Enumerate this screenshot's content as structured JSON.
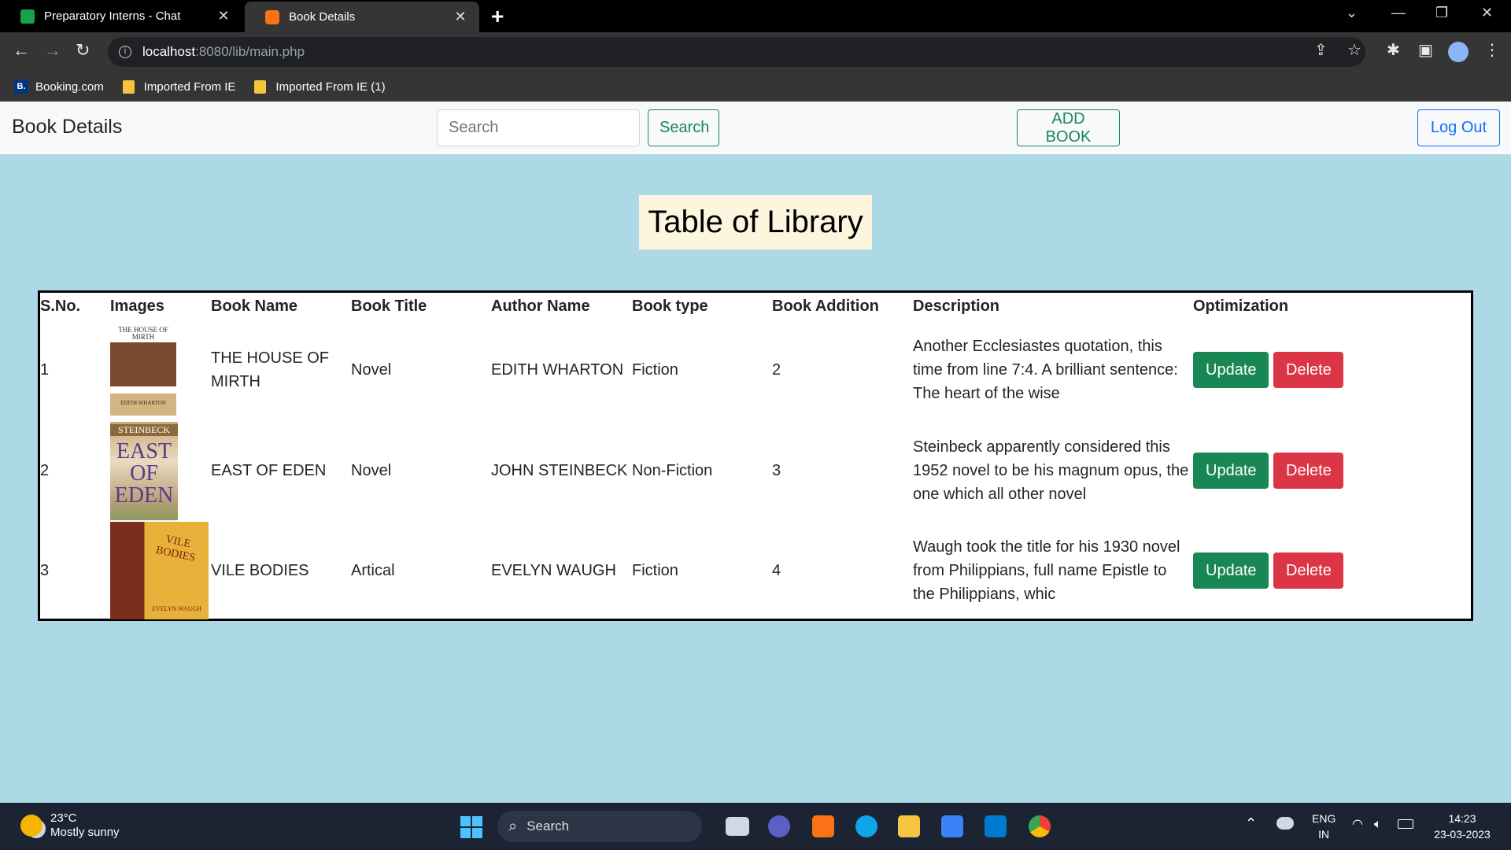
{
  "browser": {
    "tabs": [
      {
        "title": "Preparatory Interns - Chat",
        "icon": "chat-icon"
      },
      {
        "title": "Book Details",
        "icon": "xampp-icon"
      }
    ],
    "url_host": "localhost",
    "url_path": ":8080/lib/main.php",
    "bookmarks": [
      "Booking.com",
      "Imported From IE",
      "Imported From IE (1)"
    ]
  },
  "navbar": {
    "brand": "Book Details",
    "search_placeholder": "Search",
    "search_button": "Search",
    "add_button": "ADD BOOK",
    "logout_button": "Log Out"
  },
  "heading": "Table of Library",
  "table": {
    "headers": [
      "S.No.",
      "Images",
      "Book Name",
      "Book Title",
      "Author Name",
      "Book type",
      "Book Addition",
      "Description",
      "Optimization"
    ],
    "rows": [
      {
        "sno": "1",
        "cover_text_top": "THE HOUSE OF MIRTH",
        "cover_text_bottom": "EDITH WHARTON",
        "book_name": "THE HOUSE OF MIRTH",
        "book_title": "Novel",
        "author": "EDITH WHARTON",
        "type": "Fiction",
        "addition": "2",
        "description": "Another Ecclesiastes quotation, this time from line 7:4. A brilliant sentence: The heart of the wise"
      },
      {
        "sno": "2",
        "cover_text_top": "STEINBECK",
        "cover_text_main": "EAST OF EDEN",
        "book_name": "EAST OF EDEN",
        "book_title": "Novel",
        "author": "JOHN STEINBECK",
        "type": "Non-Fiction",
        "addition": "3",
        "description": "Steinbeck apparently considered this 1952 novel to be his magnum opus, the one which all other novel"
      },
      {
        "sno": "3",
        "cover_text_main": "VILE BODIES",
        "cover_text_bottom": "EVELYN WAUGH",
        "book_name": "VILE BODIES",
        "book_title": "Artical",
        "author": "EVELYN WAUGH",
        "type": "Fiction",
        "addition": "4",
        "description": "Waugh took the title for his 1930 novel from Philippians, full name Epistle to the Philippians, whic"
      }
    ],
    "update_label": "Update",
    "delete_label": "Delete"
  },
  "taskbar": {
    "temperature": "23°C",
    "weather": "Mostly sunny",
    "search_label": "Search",
    "lang_top": "ENG",
    "lang_bottom": "IN",
    "time": "14:23",
    "date": "23-03-2023"
  },
  "colors": {
    "page_bg": "#add8e6",
    "heading_bg": "#fdf6df",
    "success": "#198754",
    "danger": "#dc3545",
    "primary": "#0d6efd"
  }
}
